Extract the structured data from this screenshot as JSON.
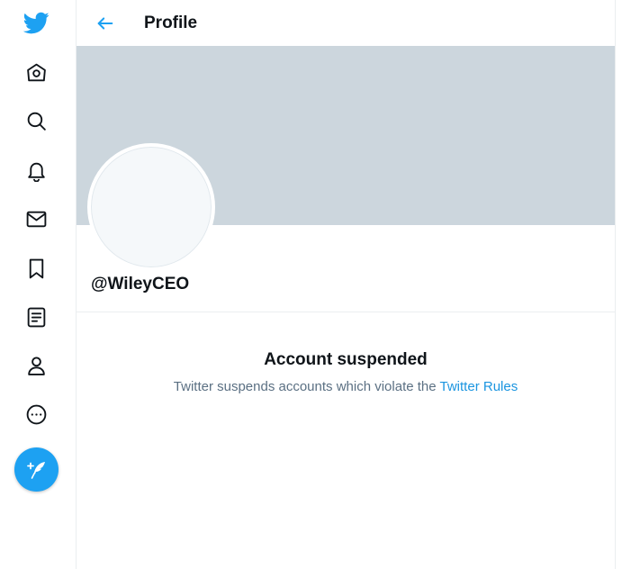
{
  "header": {
    "title": "Profile"
  },
  "profile": {
    "handle": "@WileyCEO"
  },
  "notice": {
    "title": "Account suspended",
    "message_prefix": "Twitter suspends accounts which violate the",
    "link_label": "Twitter Rules"
  },
  "sidebar": {
    "icons": [
      "twitter-logo-icon",
      "home-icon",
      "search-icon",
      "bell-icon",
      "mail-icon",
      "bookmark-icon",
      "list-icon",
      "profile-icon",
      "more-icon"
    ],
    "compose_icon": "feather-plus-icon"
  },
  "colors": {
    "accent": "#1da1f2",
    "banner": "#ccd6dd",
    "avatar_fill": "#f5f8fa",
    "secondary_text": "#5b7083",
    "link": "#1b95e0"
  }
}
